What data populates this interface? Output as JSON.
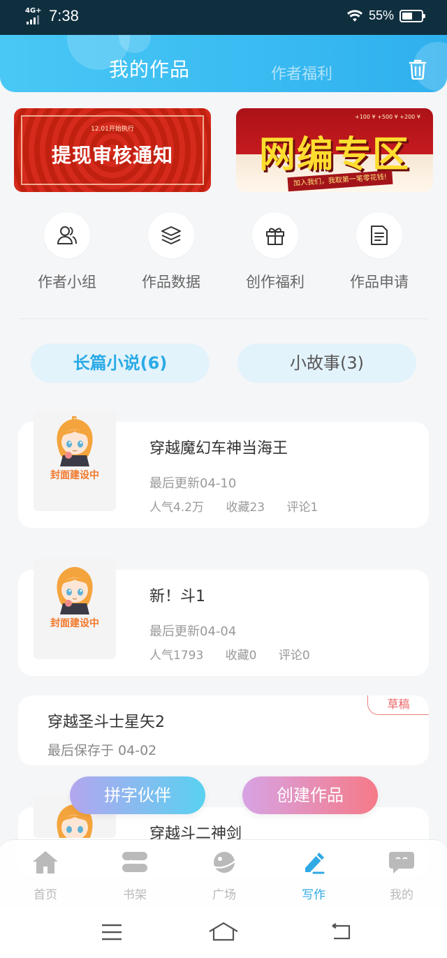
{
  "status_bar": {
    "network": "4G+",
    "time": "7:38",
    "battery": "55%",
    "battery_level": 0.55
  },
  "header": {
    "title": "我的作品",
    "secondary_tab": "作者福利"
  },
  "banners": {
    "left": {
      "small_text": "12.01开始执行",
      "title": "提现审核通知"
    },
    "right": {
      "title": "网编专区",
      "slogan": "加入我们，我取第一笔零花钱!",
      "money": "+100 ¥  +500 ¥  +200 ¥"
    }
  },
  "entries": [
    {
      "label": "作者小组",
      "icon": "users-icon"
    },
    {
      "label": "作品数据",
      "icon": "layers-icon"
    },
    {
      "label": "创作福利",
      "icon": "gift-icon"
    },
    {
      "label": "作品申请",
      "icon": "document-icon"
    }
  ],
  "categories": [
    {
      "label": "长篇小说(6)",
      "active": true
    },
    {
      "label": "小故事(3)",
      "active": false
    }
  ],
  "cover_text": "封面建设中",
  "books": [
    {
      "title": "穿越魔幻车神当海王",
      "updated": "最后更新04-10",
      "popularity": "人气4.2万",
      "favorites": "收藏23",
      "comments": "评论1"
    },
    {
      "title": "新！斗1",
      "updated": "最后更新04-04",
      "popularity": "人气1793",
      "favorites": "收藏0",
      "comments": "评论0"
    }
  ],
  "draft": {
    "title": "穿越圣斗士星矢2",
    "saved": "最后保存于 04-02",
    "tag": "草稿"
  },
  "partial_book": {
    "title": "穿越斗二神剑"
  },
  "floating_buttons": {
    "partner": "拼字伙伴",
    "create": "创建作品"
  },
  "tabbar": [
    {
      "label": "首页",
      "icon": "home-icon",
      "active": false
    },
    {
      "label": "书架",
      "icon": "bookshelf-icon",
      "active": false
    },
    {
      "label": "广场",
      "icon": "planet-icon",
      "active": false
    },
    {
      "label": "写作",
      "icon": "pen-icon",
      "active": true
    },
    {
      "label": "我的",
      "icon": "chat-face-icon",
      "active": false
    }
  ],
  "colors": {
    "accent": "#2aa7e4",
    "header_gradient_start": "#49c8f5",
    "create_gradient_end": "#f57a88",
    "cover_text": "#f1792b"
  }
}
